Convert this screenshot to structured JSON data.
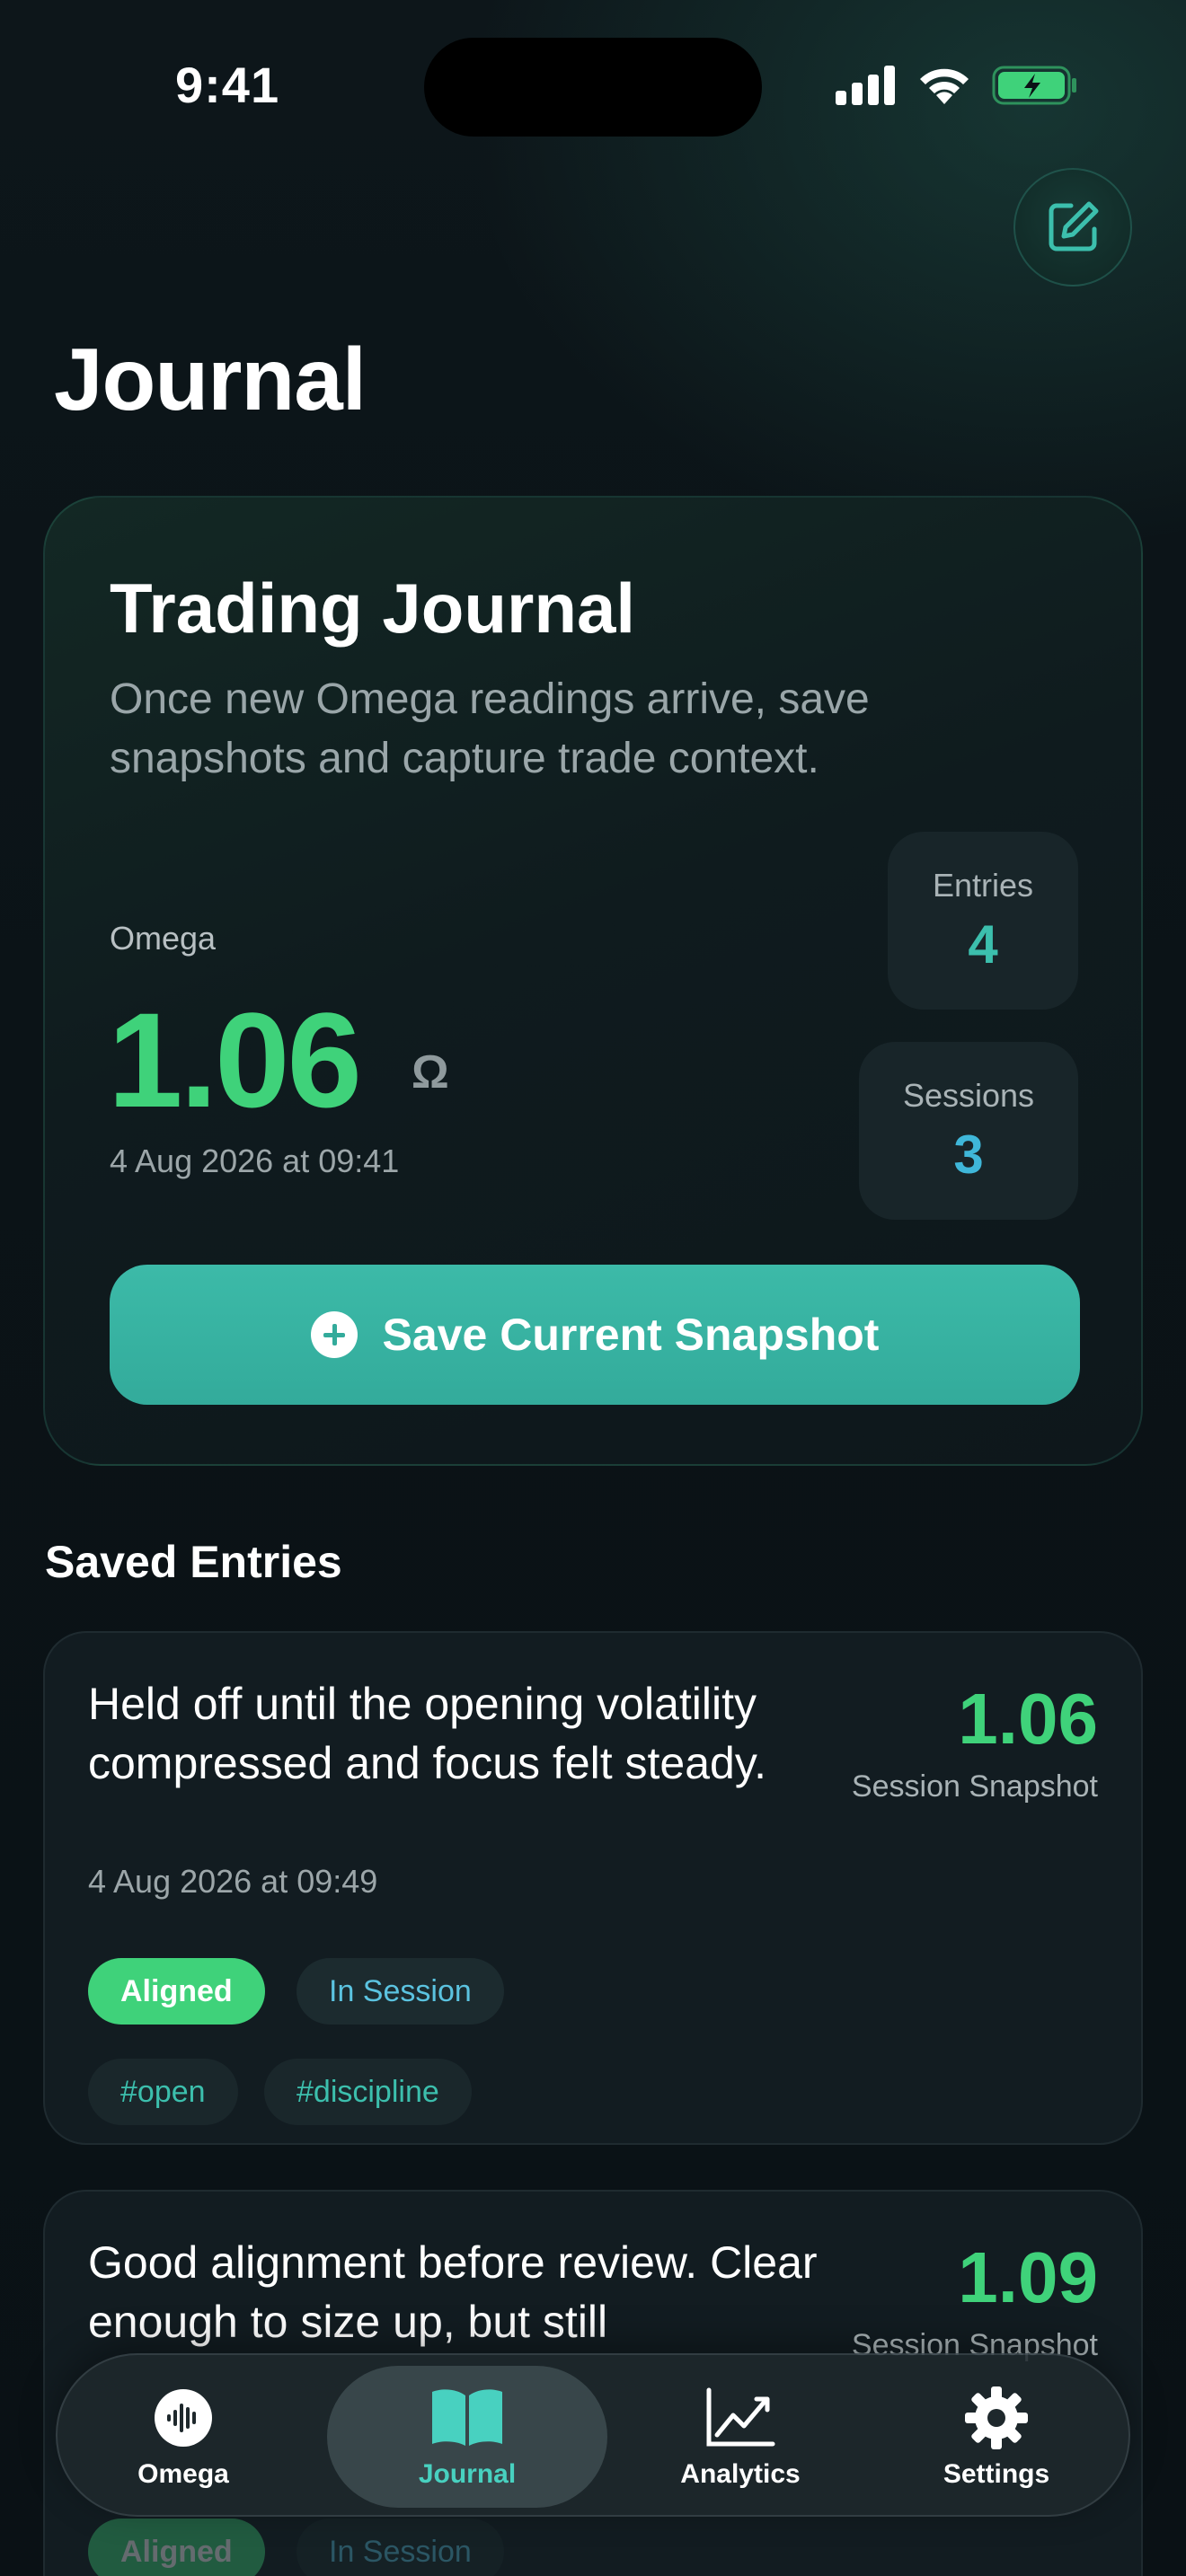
{
  "status_bar": {
    "time": "9:41"
  },
  "header": {
    "title": "Journal"
  },
  "hero": {
    "title": "Trading Journal",
    "subtitle": "Once new Omega readings arrive, save snapshots and capture trade context.",
    "omega_label": "Omega",
    "omega_value": "1.06",
    "omega_symbol": "Ω",
    "timestamp": "4 Aug 2026 at 09:41",
    "entries_label": "Entries",
    "entries_value": "4",
    "sessions_label": "Sessions",
    "sessions_value": "3",
    "save_button_label": "Save Current Snapshot"
  },
  "saved_entries": {
    "title": "Saved Entries",
    "items": [
      {
        "text": "Held off until the opening volatility compressed and focus felt steady.",
        "timestamp": "4 Aug 2026 at 09:49",
        "score": "1.06",
        "score_label": "Session Snapshot",
        "status": "Aligned",
        "session": "In Session",
        "tags": [
          "#open",
          "#discipline"
        ]
      },
      {
        "text": "Good alignment before review. Clear enough to size up, but still",
        "timestamp": "",
        "score": "1.09",
        "score_label": "Session Snapshot",
        "status": "Aligned",
        "session": "In Session",
        "tags": []
      }
    ]
  },
  "tab_bar": {
    "tabs": [
      {
        "label": "Omega",
        "icon": "waveform-icon"
      },
      {
        "label": "Journal",
        "icon": "book-icon",
        "active": true
      },
      {
        "label": "Analytics",
        "icon": "chart-line-icon"
      },
      {
        "label": "Settings",
        "icon": "gear-icon"
      }
    ]
  },
  "colors": {
    "accent_teal": "#3cbaa8",
    "omega_green": "#3fd27a",
    "session_blue": "#5bc3e0",
    "background": "#0b1216"
  }
}
